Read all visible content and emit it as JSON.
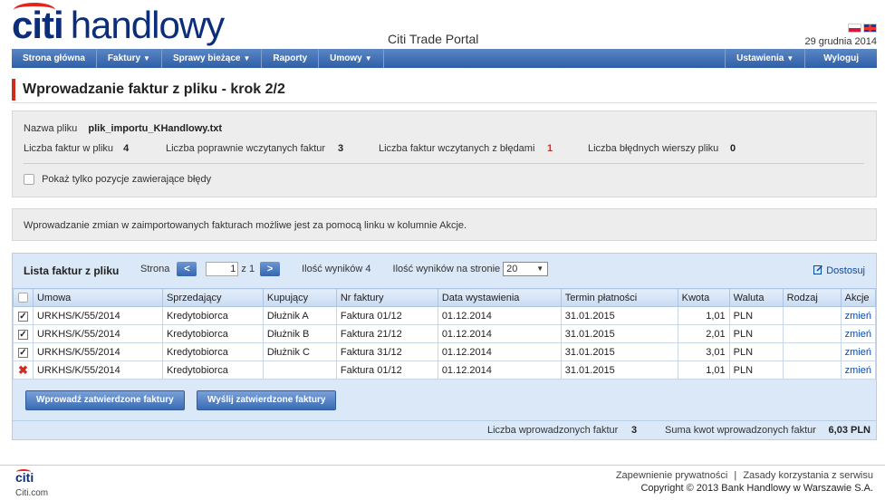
{
  "header": {
    "logo_citi": "citi",
    "logo_rest": "handlowy",
    "portal_title": "Citi Trade Portal",
    "date": "29 grudnia 2014",
    "flags": [
      "pl-flag-icon",
      "uk-flag-icon"
    ]
  },
  "nav": {
    "items": [
      {
        "label": "Strona główna",
        "dropdown": false
      },
      {
        "label": "Faktury",
        "dropdown": true
      },
      {
        "label": "Sprawy bieżące",
        "dropdown": true
      },
      {
        "label": "Raporty",
        "dropdown": false
      },
      {
        "label": "Umowy",
        "dropdown": true
      }
    ],
    "right": [
      {
        "label": "Ustawienia",
        "dropdown": true
      },
      {
        "label": "Wyloguj",
        "dropdown": false
      }
    ],
    "caret": "▼"
  },
  "page_title": "Wprowadzanie faktur z pliku - krok 2/2",
  "file_info": {
    "file_label": "Nazwa pliku",
    "file_value": "plik_importu_KHandlowy.txt",
    "count_label": "Liczba faktur w pliku",
    "count_value": "4",
    "ok_label": "Liczba poprawnie wczytanych faktur",
    "ok_value": "3",
    "err_label": "Liczba faktur wczytanych z błędami",
    "err_value": "1",
    "bad_rows_label": "Liczba błędnych wierszy pliku",
    "bad_rows_value": "0",
    "only_errors_label": "Pokaż tylko pozycje zawierające błędy"
  },
  "info_text": "Wprowadzanie zmian w zaimportowanych fakturach możliwe jest za pomocą linku w kolumnie Akcje.",
  "list": {
    "title": "Lista faktur z pliku",
    "page_label": "Strona",
    "prev": "<",
    "page_value": "1",
    "of_label": "z 1",
    "next": ">",
    "results_label": "Ilość wyników 4",
    "per_page_label": "Ilość wyników na stronie",
    "per_page_value": "20",
    "customize": "Dostosuj",
    "columns": [
      "Umowa",
      "Sprzedający",
      "Kupujący",
      "Nr faktury",
      "Data wystawienia",
      "Termin płatności",
      "Kwota",
      "Waluta",
      "Rodzaj",
      "Akcje"
    ],
    "rows": [
      {
        "status": "checked",
        "mark": "✓",
        "umowa": "URKHS/K/55/2014",
        "sprzedajacy": "Kredytobiorca",
        "kupujacy": "Dłużnik A",
        "nr": "Faktura 01/12",
        "data": "01.12.2014",
        "termin": "31.01.2015",
        "kwota": "1,01",
        "waluta": "PLN",
        "rodzaj": "",
        "akcja": "zmień"
      },
      {
        "status": "checked",
        "mark": "✓",
        "umowa": "URKHS/K/55/2014",
        "sprzedajacy": "Kredytobiorca",
        "kupujacy": "Dłużnik B",
        "nr": "Faktura 21/12",
        "data": "01.12.2014",
        "termin": "31.01.2015",
        "kwota": "2,01",
        "waluta": "PLN",
        "rodzaj": "",
        "akcja": "zmień"
      },
      {
        "status": "checked",
        "mark": "✓",
        "umowa": "URKHS/K/55/2014",
        "sprzedajacy": "Kredytobiorca",
        "kupujacy": "Dłużnik C",
        "nr": "Faktura 31/12",
        "data": "01.12.2014",
        "termin": "31.01.2015",
        "kwota": "3,01",
        "waluta": "PLN",
        "rodzaj": "",
        "akcja": "zmień"
      },
      {
        "status": "error",
        "mark": "✖",
        "umowa": "URKHS/K/55/2014",
        "sprzedajacy": "Kredytobiorca",
        "kupujacy": "",
        "nr": "Faktura 01/12",
        "data": "01.12.2014",
        "termin": "31.01.2015",
        "kwota": "1,01",
        "waluta": "PLN",
        "rodzaj": "",
        "akcja": "zmień"
      }
    ],
    "submit_button": "Wprowadź zatwierdzone faktury",
    "send_button": "Wyślij zatwierdzone faktury",
    "entered_label": "Liczba wprowadzonych faktur",
    "entered_value": "3",
    "sum_label": "Suma kwot wprowadzonych faktur",
    "sum_value": "6,03 PLN"
  },
  "footer": {
    "logo": "citi",
    "site": "Citi.com",
    "privacy": "Zapewnienie prywatności",
    "divider": "|",
    "terms": "Zasady korzystania z serwisu",
    "copyright": "Copyright © 2013 Bank Handlowy w Warszawie S.A."
  },
  "colors": {
    "brand_blue": "#0b2d7a",
    "accent_red": "#d12c21",
    "nav_blue": "#2f5fa8",
    "panel_blue": "#dbe8f7"
  }
}
